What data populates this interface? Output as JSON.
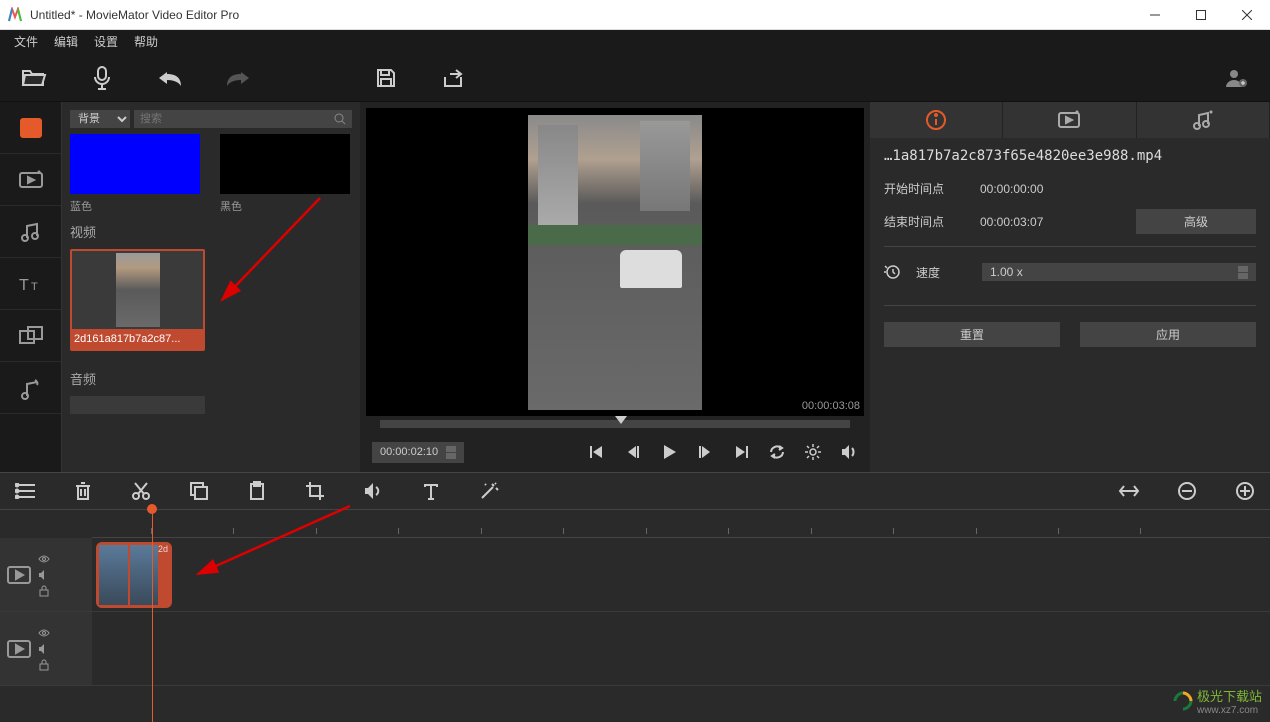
{
  "window": {
    "title": "Untitled* - MovieMator Video Editor Pro"
  },
  "menu": {
    "items": [
      "文件",
      "编辑",
      "设置",
      "帮助"
    ]
  },
  "mediaPanel": {
    "filterSelect": "背景",
    "searchPlaceholder": "搜索",
    "backgrounds": [
      {
        "label": "蓝色",
        "color": "#0000ff"
      },
      {
        "label": "黑色",
        "color": "#000000"
      }
    ],
    "videoSection": "视频",
    "videoClip": {
      "name": "2d161a817b7a2c87..."
    },
    "audioSection": "音频"
  },
  "preview": {
    "scrubTime": "00:00:03:08",
    "timecode": "00:00:02:10"
  },
  "properties": {
    "filename": "…1a817b7a2c873f65e4820ee3e988.mp4",
    "startLabel": "开始时间点",
    "startValue": "00:00:00:00",
    "endLabel": "结束时间点",
    "endValue": "00:00:03:07",
    "advancedBtn": "高级",
    "speedLabel": "速度",
    "speedValue": "1.00 x",
    "resetBtn": "重置",
    "applyBtn": "应用"
  },
  "timelineClip": {
    "label": "2d"
  },
  "watermark": {
    "brand": "极光下载站",
    "url": "www.xz7.com"
  }
}
